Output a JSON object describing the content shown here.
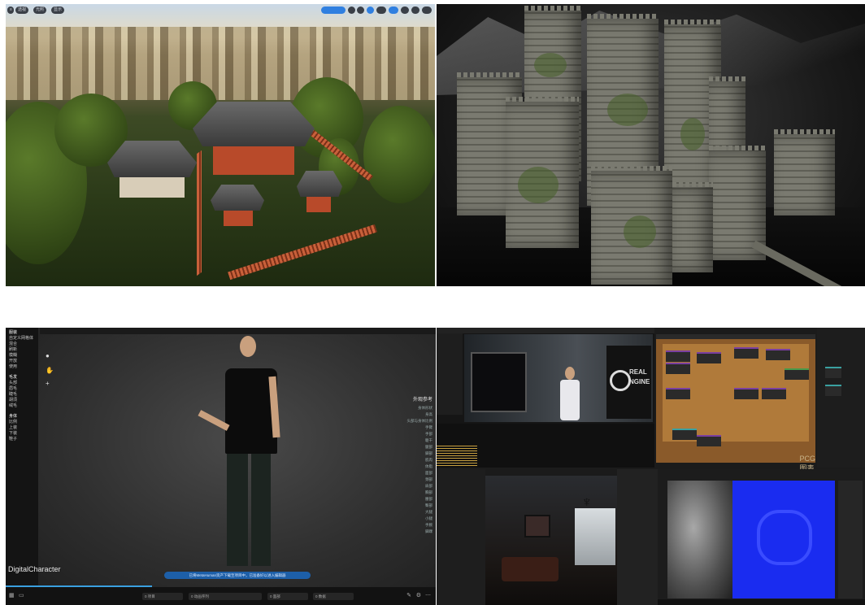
{
  "panels": {
    "top_left": {
      "toolbar_left": [
        "透视",
        "光照",
        "显示"
      ],
      "toolbar_right_count": 9
    },
    "bottom_left": {
      "sidebar_sections": [
        {
          "title": "服装",
          "items": [
            "自定义网格体",
            "混合",
            "刷新",
            "模糊",
            "开放",
            "使用"
          ]
        },
        {
          "title": "毛发",
          "items": [
            "头部",
            "眉毛",
            "睫毛",
            "胡须",
            "绒毛"
          ]
        },
        {
          "title": "身体",
          "items": [
            "比例",
            "上装",
            "下装",
            "鞋子"
          ]
        }
      ],
      "panel_heading": "外观参考",
      "right_list": [
        "身体形状",
        "身高",
        "头部与身体比例",
        "手臂",
        "手部",
        "躯干",
        "腿部",
        "脚部",
        "肌肉",
        "体脂",
        "面部",
        "颈部",
        "肩部",
        "胸部",
        "腰部",
        "臀部",
        "大腿",
        "小腿",
        "手腕",
        "脚踝"
      ],
      "app_label": "DigitalCharacter",
      "banner_text": "已将MetaHuman资产下载至项目中，已准备好以进入编辑器",
      "bottom_fields": [
        "0 项目",
        "0 动画序列",
        "0 面部",
        "0 数据"
      ]
    },
    "bottom_right": {
      "graph_label": "PCG图表",
      "logo_text_1": "REAL",
      "logo_text_2": "NGINE"
    }
  }
}
